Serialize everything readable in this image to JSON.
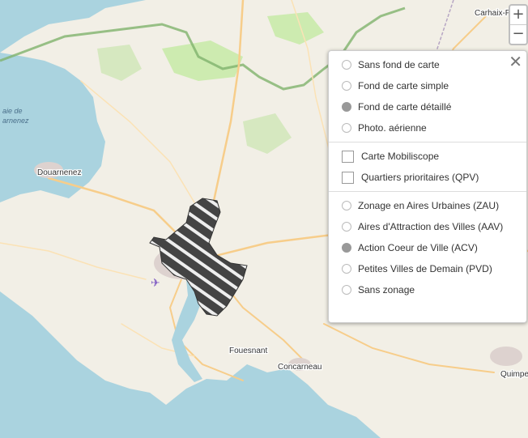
{
  "map": {
    "places": {
      "carhaix": "Carhaix-P",
      "douarnenez": "Douarnenez",
      "fouesnant": "Fouesnant",
      "concarneau": "Concarneau",
      "quimper": "Quimpe"
    },
    "sea_label_lines": [
      "aie de",
      "arnenez"
    ]
  },
  "zoom": {
    "in": "+",
    "out": "−"
  },
  "panel": {
    "close": "✕",
    "basemaps": [
      {
        "label": "Sans fond de carte",
        "selected": false
      },
      {
        "label": "Fond de carte simple",
        "selected": false
      },
      {
        "label": "Fond de carte détaillé",
        "selected": true
      },
      {
        "label": "Photo. aérienne",
        "selected": false
      }
    ],
    "overlays": [
      {
        "label": "Carte Mobiliscope",
        "checked": false
      },
      {
        "label": "Quartiers prioritaires (QPV)",
        "checked": false
      }
    ],
    "zonings": [
      {
        "label": "Zonage en Aires Urbaines (ZAU)",
        "selected": false
      },
      {
        "label": "Aires d'Attraction des Villes (AAV)",
        "selected": false
      },
      {
        "label": "Action Coeur de Ville (ACV)",
        "selected": true
      },
      {
        "label": "Petites Villes de Demain (PVD)",
        "selected": false
      },
      {
        "label": "Sans zonage",
        "selected": false
      }
    ]
  }
}
